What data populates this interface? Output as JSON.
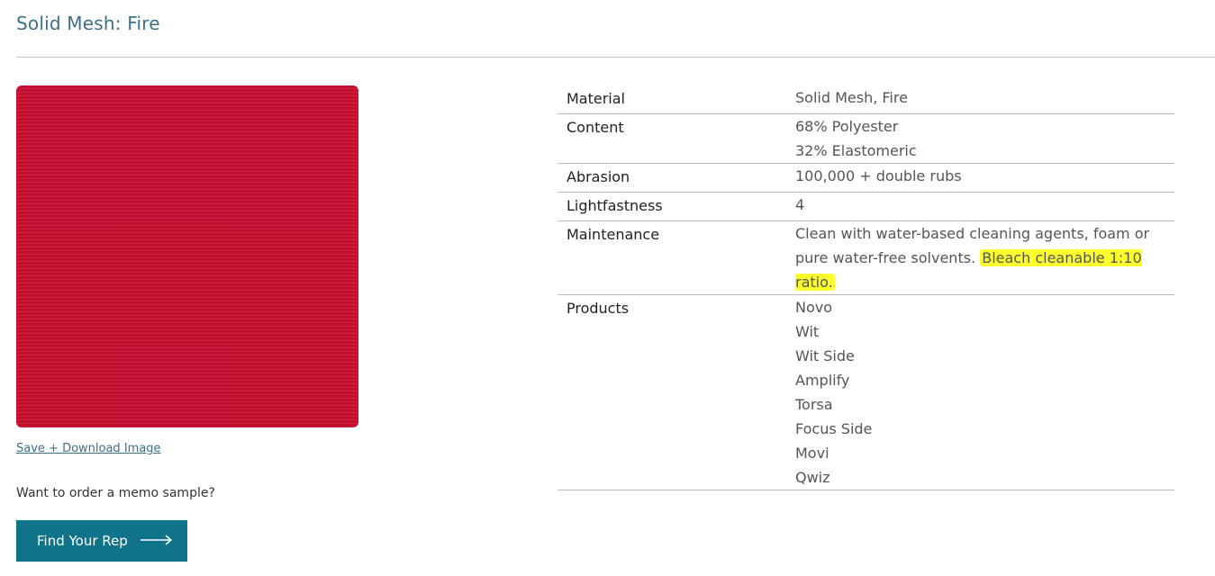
{
  "header": {
    "title": "Solid Mesh: Fire"
  },
  "swatch": {
    "color": "#cb0e30"
  },
  "links": {
    "download": "Save + Download Image"
  },
  "memo": {
    "text": "Want to order a memo sample?",
    "button_label": "Find Your Rep",
    "button_icon": "long-arrow-right-icon"
  },
  "specs": {
    "material": {
      "label": "Material",
      "value": "Solid Mesh, Fire"
    },
    "content": {
      "label": "Content",
      "values": [
        "68% Polyester",
        "32% Elastomeric"
      ]
    },
    "abrasion": {
      "label": "Abrasion",
      "value": "100,000 + double rubs"
    },
    "lightfastness": {
      "label": "Lightfastness",
      "value": "4"
    },
    "maintenance": {
      "label": "Maintenance",
      "text": "Clean with water-based cleaning agents, foam or pure water-free solvents.",
      "highlight": "Bleach cleanable 1:10 ratio."
    },
    "products": {
      "label": "Products",
      "values": [
        "Novo",
        "Wit",
        "Wit Side",
        "Amplify",
        "Torsa",
        "Focus Side",
        "Movi",
        "Qwiz"
      ]
    }
  },
  "colors": {
    "accent": "#0f7489",
    "title": "#3d6f86",
    "highlight": "#fcff2e"
  }
}
